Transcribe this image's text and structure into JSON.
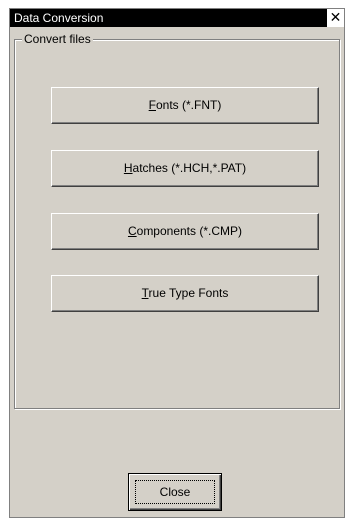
{
  "window": {
    "title": "Data Conversion",
    "close_glyph": "✕"
  },
  "group": {
    "label": "Convert files"
  },
  "buttons": [
    {
      "mnemonic": "F",
      "rest": "onts  (*.FNT)"
    },
    {
      "mnemonic": "H",
      "rest": "atches (*.HCH,*.PAT)"
    },
    {
      "mnemonic": "C",
      "rest": "omponents (*.CMP)"
    },
    {
      "mnemonic": "T",
      "rest": "rue Type Fonts"
    }
  ],
  "footer": {
    "close_label": "Close"
  }
}
